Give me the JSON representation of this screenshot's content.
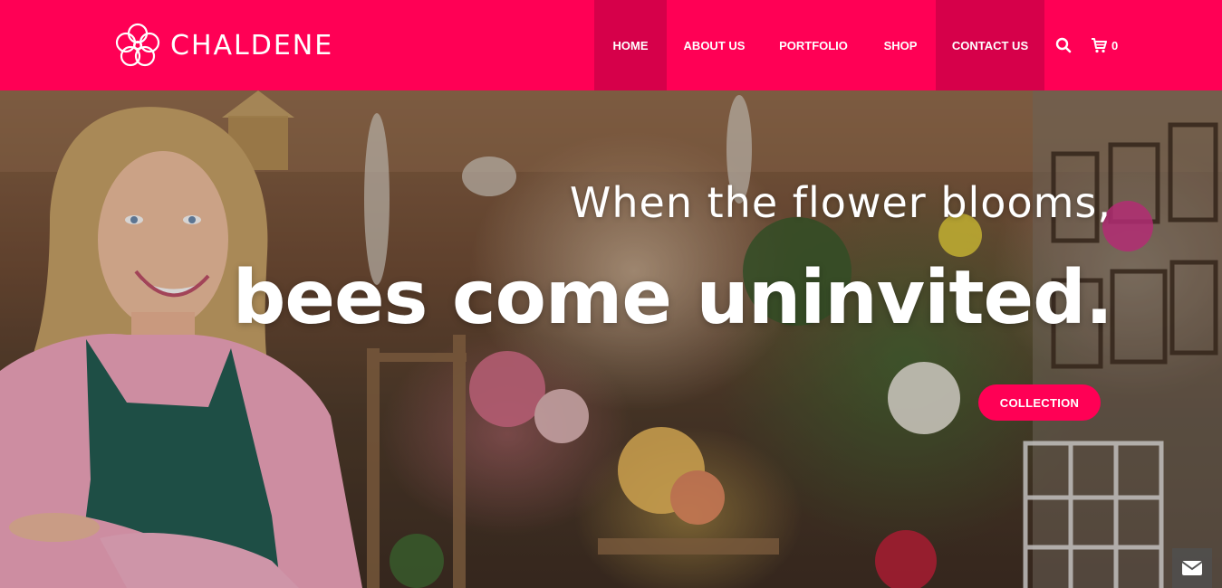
{
  "brand": {
    "name": "CHALDENE",
    "logo_icon": "flower-icon"
  },
  "colors": {
    "accent": "#ff0055",
    "accent_dark": "#d6004a",
    "text_light": "#ffffff"
  },
  "nav": {
    "items": [
      {
        "label": "HOME",
        "active": true
      },
      {
        "label": "ABOUT US",
        "active": false
      },
      {
        "label": "PORTFOLIO",
        "active": false
      },
      {
        "label": "SHOP",
        "active": false
      },
      {
        "label": "CONTACT US",
        "active": true
      }
    ],
    "search_icon": "search-icon",
    "cart_icon": "cart-icon",
    "cart_count": "0"
  },
  "hero": {
    "subtitle": "When the flower blooms,",
    "title": "bees come uninvited.",
    "cta_label": "COLLECTION"
  },
  "floating": {
    "mail_icon": "envelope-icon"
  }
}
